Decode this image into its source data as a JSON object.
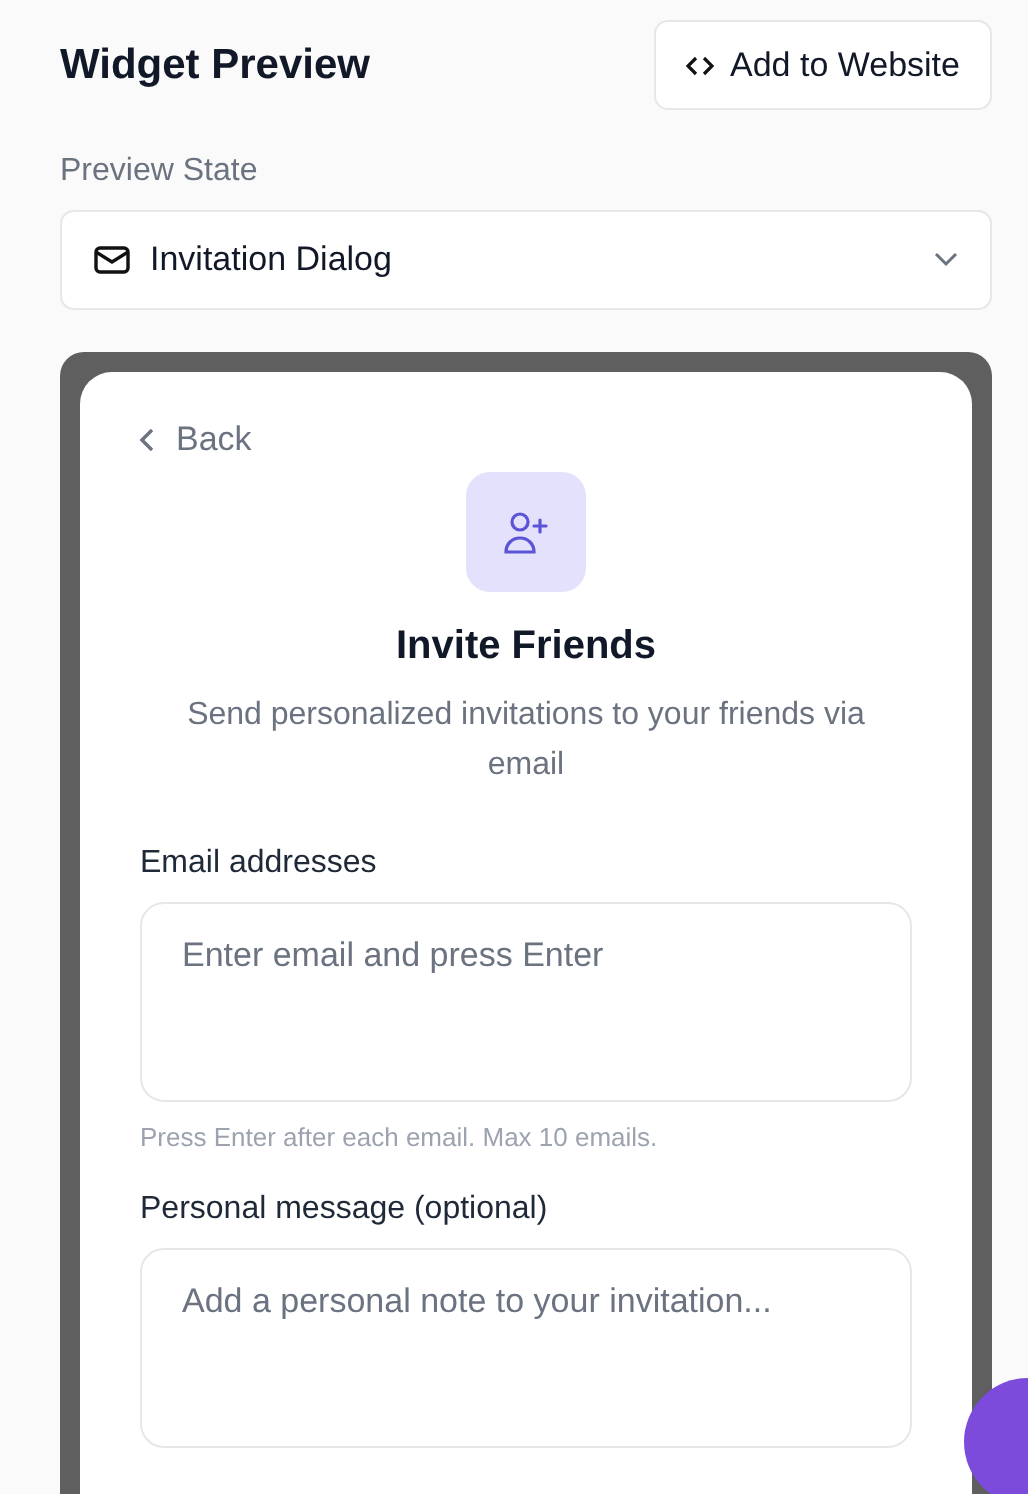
{
  "header": {
    "title": "Widget Preview",
    "action_button": "Add to Website"
  },
  "preview_state": {
    "label": "Preview State",
    "value": "Invitation Dialog"
  },
  "dialog": {
    "back": "Back",
    "title": "Invite Friends",
    "subtitle": "Send personalized invitations to your friends via email",
    "fields": [
      {
        "label": "Email addresses",
        "placeholder": "Enter email and press Enter",
        "hint": "Press Enter after each email. Max 10 emails."
      },
      {
        "label": "Personal message (optional)",
        "placeholder": "Add a personal note to your invitation..."
      }
    ]
  }
}
